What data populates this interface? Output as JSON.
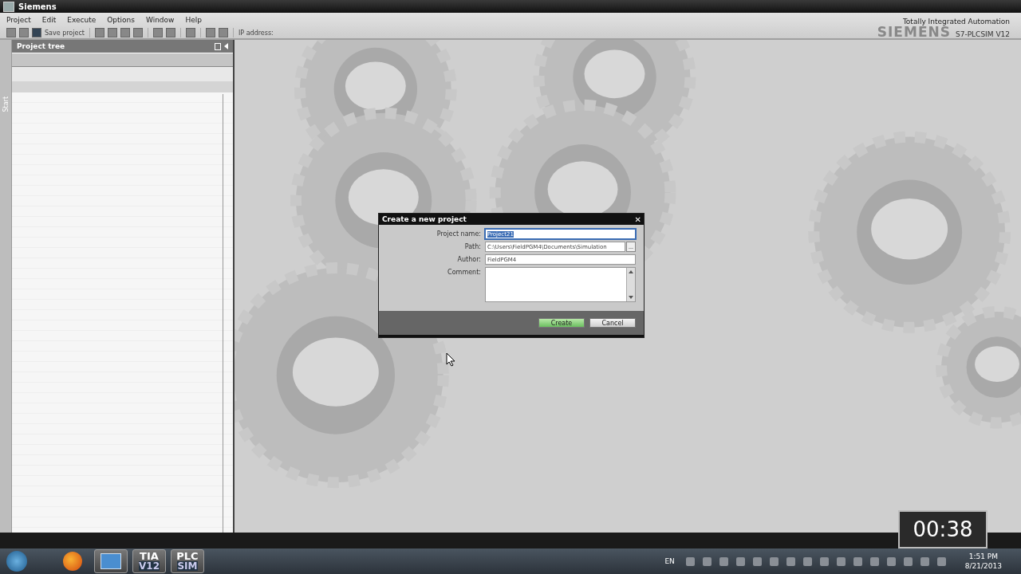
{
  "window": {
    "title": "Siemens"
  },
  "menu": [
    "Project",
    "Edit",
    "Execute",
    "Options",
    "Window",
    "Help"
  ],
  "toolbar": {
    "save_label": "Save project",
    "ip_label": "IP address:"
  },
  "branding": {
    "tagline": "Totally Integrated Automation",
    "logo": "SIEMENS",
    "product": "S7-PLCSIM V12"
  },
  "side_tab": {
    "label": "Start"
  },
  "project_tree": {
    "title": "Project tree"
  },
  "dialog": {
    "title": "Create a new project",
    "close": "✕",
    "fields": [
      {
        "label": "Project name:",
        "value": "Project21",
        "selected": true,
        "kind": "text"
      },
      {
        "label": "Path:",
        "value": "C:\\Users\\FieldPGM4\\Documents\\Simulation",
        "selected": false,
        "kind": "browse",
        "browse": "..."
      },
      {
        "label": "Author:",
        "value": "FieldPGM4",
        "selected": false,
        "kind": "text"
      },
      {
        "label": "Comment:",
        "selected": false,
        "kind": "textarea"
      }
    ],
    "buttons": [
      {
        "label": "Create",
        "kind": "primary"
      },
      {
        "label": "Cancel",
        "kind": "secondary"
      }
    ]
  },
  "recording_timer": "00:38",
  "taskbar": {
    "apps": [
      {
        "kind": "firefox"
      },
      {
        "kind": "panel"
      },
      {
        "kind": "text",
        "line1": "TIA",
        "line2": "V12"
      },
      {
        "kind": "text",
        "line1": "PLC",
        "line2": "SIM"
      }
    ],
    "language": "EN",
    "time": "1:51 PM",
    "date": "8/21/2013"
  }
}
